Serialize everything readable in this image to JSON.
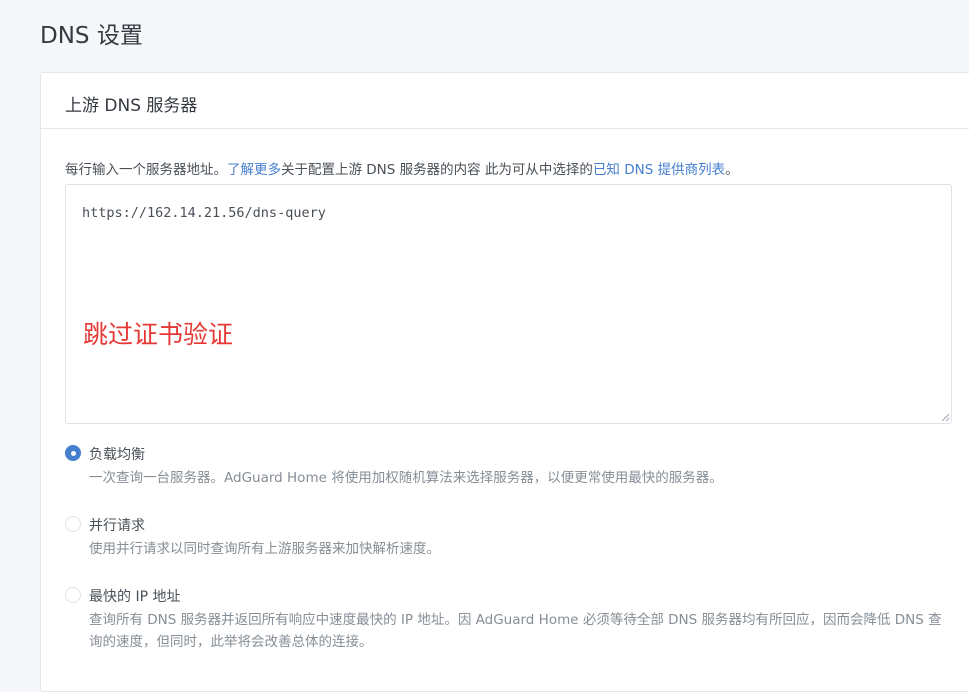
{
  "page": {
    "title": "DNS 设置"
  },
  "upstream": {
    "header": "上游 DNS 服务器",
    "desc_prefix": "每行输入一个服务器地址。",
    "learn_more": "了解更多",
    "desc_middle": "关于配置上游 DNS 服务器的内容 此为可从中选择的",
    "providers_link": "已知 DNS 提供商列表",
    "desc_suffix": "。",
    "textarea_value": "https://162.14.21.56/dns-query",
    "annotation": "跳过证书验证"
  },
  "modes": [
    {
      "label": "负载均衡",
      "description": "一次查询一台服务器。AdGuard Home 将使用加权随机算法来选择服务器，以便更常使用最快的服务器。",
      "checked": true
    },
    {
      "label": "并行请求",
      "description": "使用并行请求以同时查询所有上游服务器来加快解析速度。",
      "checked": false
    },
    {
      "label": "最快的 IP 地址",
      "description": "查询所有 DNS 服务器并返回所有响应中速度最快的 IP 地址。因 AdGuard Home 必须等待全部 DNS 服务器均有所回应，因而会降低 DNS 查询的速度，但同时，此举将会改善总体的连接。",
      "checked": false
    }
  ],
  "colors": {
    "accent": "#467fcf",
    "annotation": "#e53935"
  }
}
